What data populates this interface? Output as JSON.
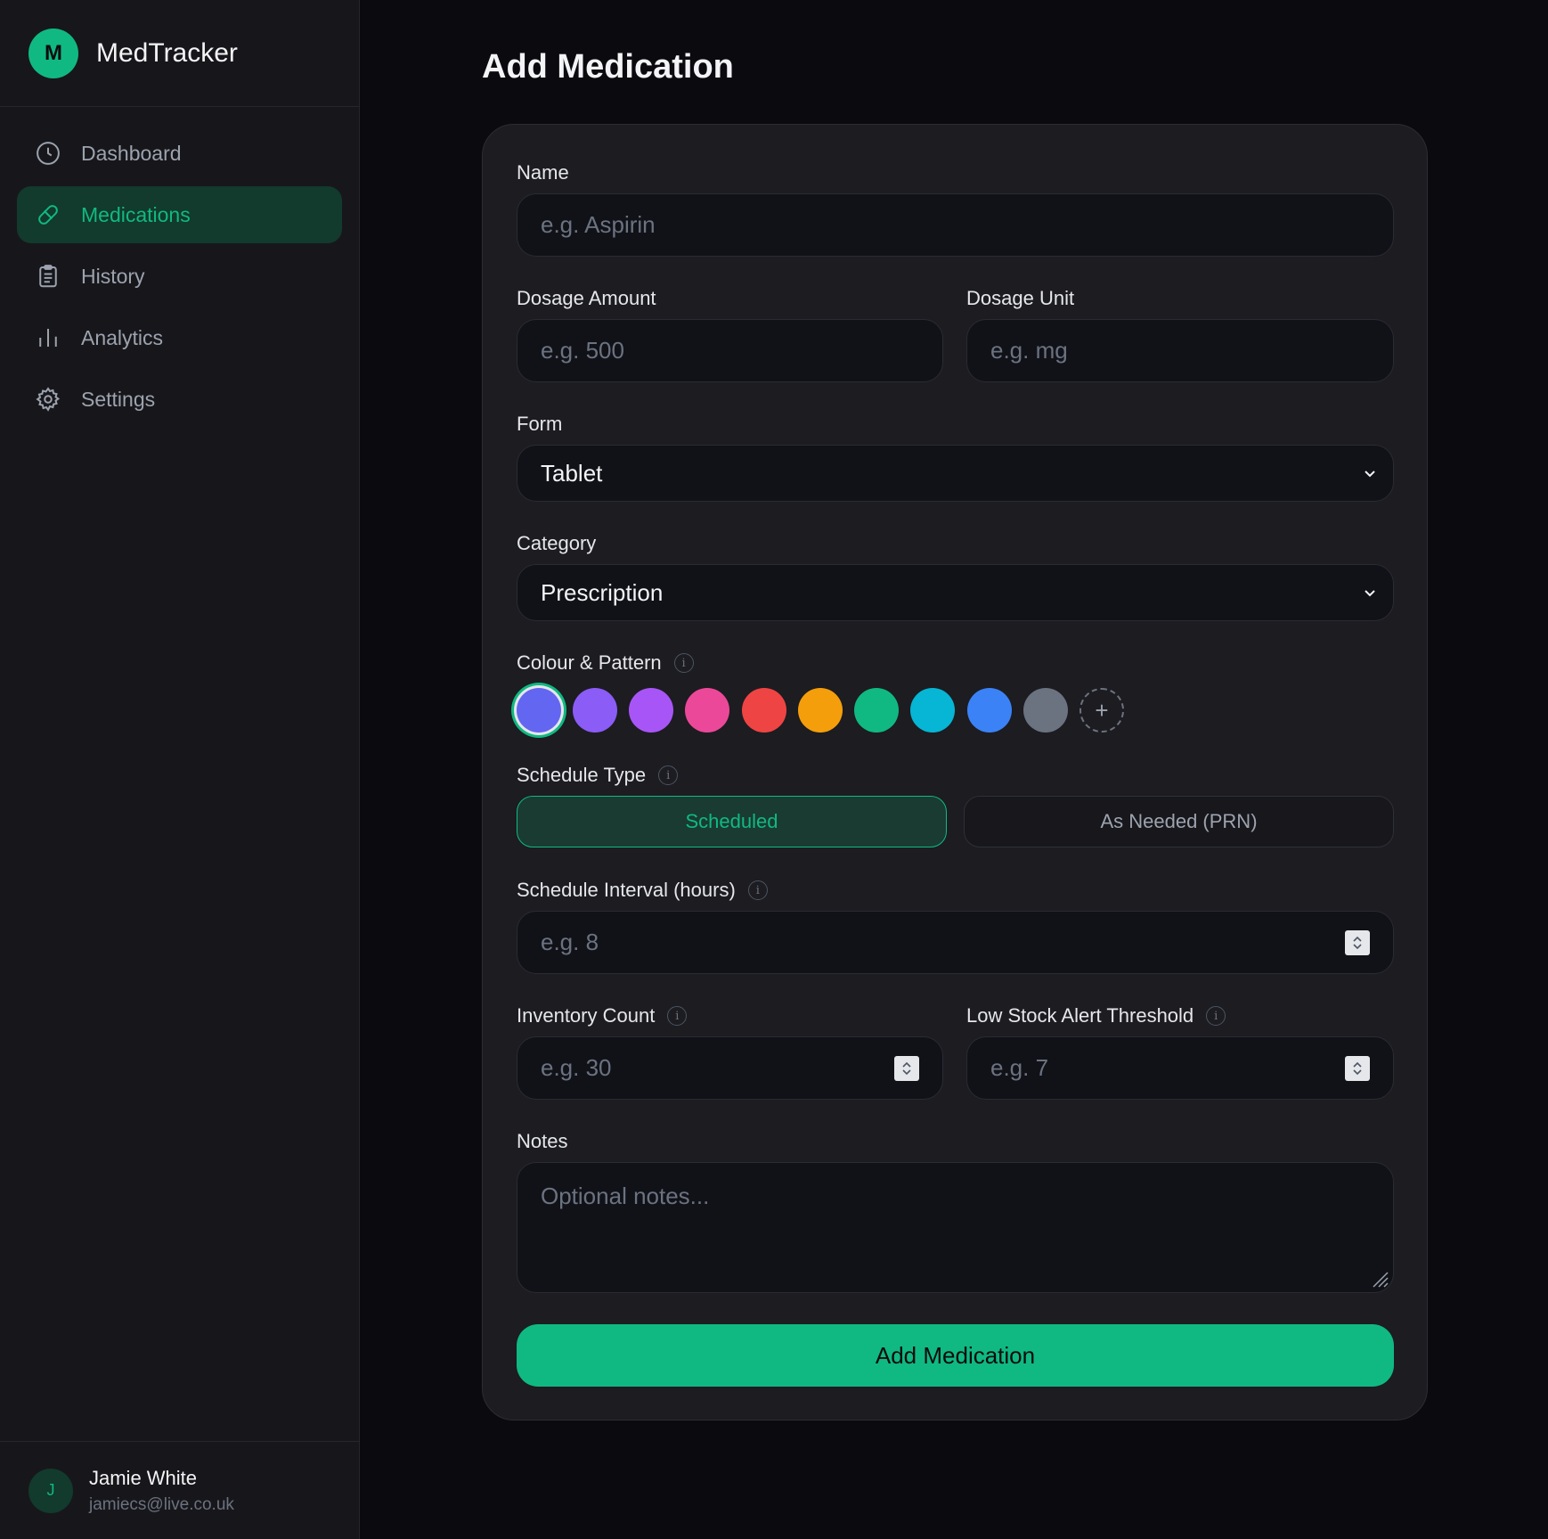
{
  "app": {
    "logo_letter": "M",
    "name": "MedTracker"
  },
  "nav": {
    "items": [
      {
        "label": "Dashboard",
        "icon": "clock-icon"
      },
      {
        "label": "Medications",
        "icon": "pill-icon",
        "active": true
      },
      {
        "label": "History",
        "icon": "clipboard-icon"
      },
      {
        "label": "Analytics",
        "icon": "bar-chart-icon"
      },
      {
        "label": "Settings",
        "icon": "gear-icon"
      }
    ]
  },
  "user": {
    "initial": "J",
    "name": "Jamie White",
    "email": "jamiecs@live.co.uk"
  },
  "page": {
    "title": "Add Medication"
  },
  "form": {
    "name": {
      "label": "Name",
      "placeholder": "e.g. Aspirin"
    },
    "dosage_amount": {
      "label": "Dosage Amount",
      "placeholder": "e.g. 500"
    },
    "dosage_unit": {
      "label": "Dosage Unit",
      "placeholder": "e.g. mg"
    },
    "form_field": {
      "label": "Form",
      "value": "Tablet"
    },
    "category": {
      "label": "Category",
      "value": "Prescription"
    },
    "colour": {
      "label": "Colour & Pattern",
      "swatches": [
        "#6366f1",
        "#8b5cf6",
        "#a855f7",
        "#ec4899",
        "#ef4444",
        "#f59e0b",
        "#10b981",
        "#06b6d4",
        "#3b82f6",
        "#6b7280"
      ],
      "selected_index": 0,
      "add_symbol": "+"
    },
    "schedule_type": {
      "label": "Schedule Type",
      "options": [
        "Scheduled",
        "As Needed (PRN)"
      ],
      "selected": "Scheduled"
    },
    "interval": {
      "label": "Schedule Interval (hours)",
      "placeholder": "e.g. 8"
    },
    "inventory": {
      "label": "Inventory Count",
      "placeholder": "e.g. 30"
    },
    "low_stock": {
      "label": "Low Stock Alert Threshold",
      "placeholder": "e.g. 7"
    },
    "notes": {
      "label": "Notes",
      "placeholder": "Optional notes..."
    },
    "submit_label": "Add Medication",
    "info_symbol": "i"
  },
  "colors": {
    "accent": "#10b981",
    "background": "#0b0b0f",
    "panel": "#1c1c21"
  }
}
